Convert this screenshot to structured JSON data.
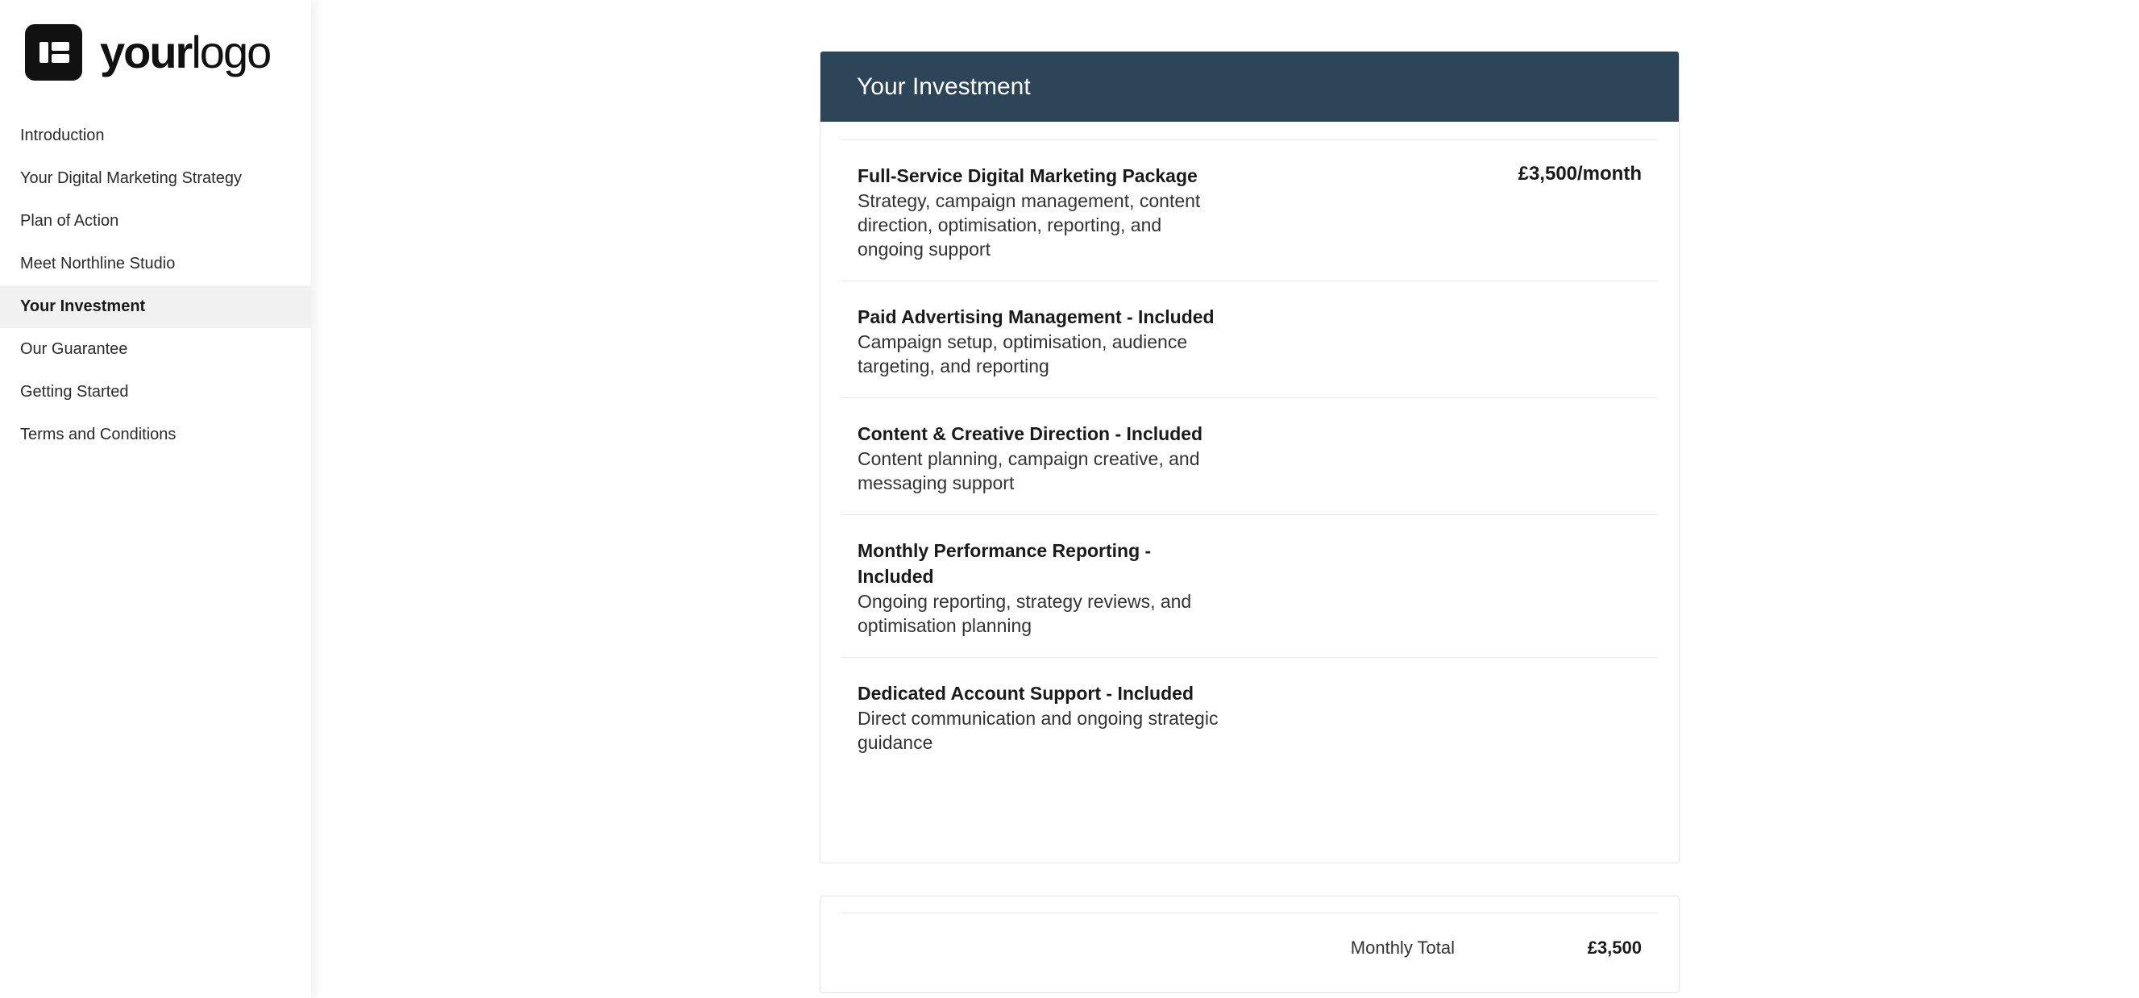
{
  "logo": {
    "bold": "your",
    "light": "logo"
  },
  "sidebar": {
    "items": [
      {
        "label": "Introduction"
      },
      {
        "label": "Your Digital Marketing Strategy"
      },
      {
        "label": "Plan of Action"
      },
      {
        "label": "Meet Northline Studio"
      },
      {
        "label": "Your Investment"
      },
      {
        "label": "Our Guarantee"
      },
      {
        "label": "Getting Started"
      },
      {
        "label": "Terms and Conditions"
      }
    ],
    "active_index": 4
  },
  "investment": {
    "title": "Your Investment",
    "items": [
      {
        "title": "Full-Service Digital Marketing Package",
        "description": "Strategy, campaign management, content direction, optimisation, reporting, and ongoing support",
        "price": "£3,500/month"
      },
      {
        "title": "Paid Advertising Management - Included",
        "description": "Campaign setup, optimisation, audience targeting, and reporting",
        "price": ""
      },
      {
        "title": "Content & Creative Direction - Included",
        "description": "Content planning, campaign creative, and messaging support",
        "price": ""
      },
      {
        "title": "Monthly Performance Reporting - Included",
        "description": "Ongoing reporting, strategy reviews, and optimisation planning",
        "price": ""
      },
      {
        "title": "Dedicated Account Support - Included",
        "description": "Direct communication and ongoing strategic guidance",
        "price": ""
      }
    ]
  },
  "total": {
    "label": "Monthly Total",
    "value": "£3,500"
  },
  "colors": {
    "header": "#2c4558",
    "active_nav": "#f1f1f1"
  }
}
